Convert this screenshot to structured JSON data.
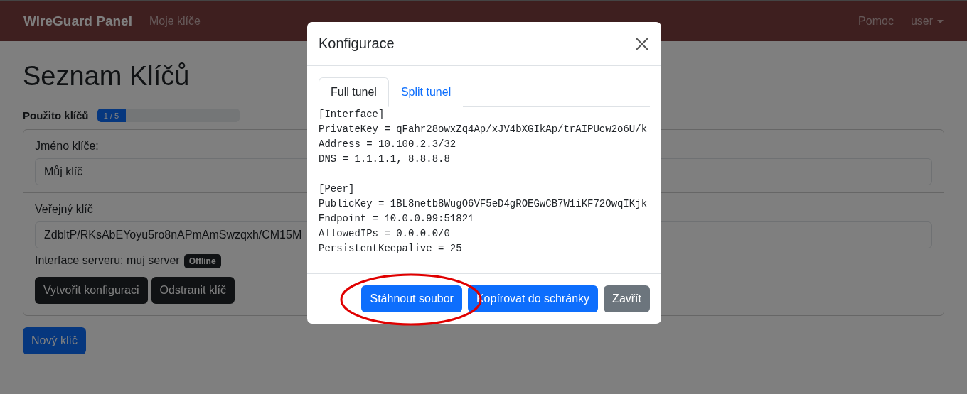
{
  "navbar": {
    "brand": "WireGuard Panel",
    "links": [
      "Moje klíče"
    ],
    "right_links": [
      "Pomoc"
    ],
    "user_menu": "user"
  },
  "page": {
    "title": "Seznam Klíčů",
    "usage": {
      "label": "Použito klíčů",
      "reading": "1 / 5",
      "level": 0.2
    },
    "key_card": {
      "name_label": "Jméno klíče:",
      "name_value": "Můj klíč",
      "public_label": "Veřejný klíč",
      "public_value": "ZdbltP/RKsAbEYoyu5ro8nAPmAmSwzqxh/CM15M",
      "server_label": "Interface serveru: muj server",
      "server_status": "Offline",
      "buttons": [
        "Vytvořit konfiguraci",
        "Odstranit klíč"
      ]
    },
    "new_button": "Nový klíč"
  },
  "modal": {
    "title": "Konfigurace",
    "tabs": [
      {
        "label": "Full tunel",
        "selected": true
      },
      {
        "label": "Split tunel",
        "selected": false
      }
    ],
    "config_sections": [
      {
        "lines": [
          "[Interface]",
          "PrivateKey = qFahr28owxZq4Ap/xJV4bXGIkAp/trAIPUcw2o6U/k",
          "Address = 10.100.2.3/32",
          "DNS = 1.1.1.1, 8.8.8.8"
        ]
      },
      {
        "lines": [
          "[Peer]",
          "PublicKey = 1BL8netb8WugO6VF5eD4gROEGwCB7W1iKF72OwqIKjk",
          "Endpoint = 10.0.0.99:51821",
          "AllowedIPs = 0.0.0.0/0",
          "PersistentKeepalive = 25"
        ]
      }
    ],
    "buttons": [
      {
        "label": "Stáhnout soubor",
        "kind": "primary",
        "highlighted": true
      },
      {
        "label": "Kopírovat do schránky",
        "kind": "primary",
        "highlighted": false
      },
      {
        "label": "Zavřít",
        "kind": "secondary",
        "highlighted": false
      }
    ]
  }
}
